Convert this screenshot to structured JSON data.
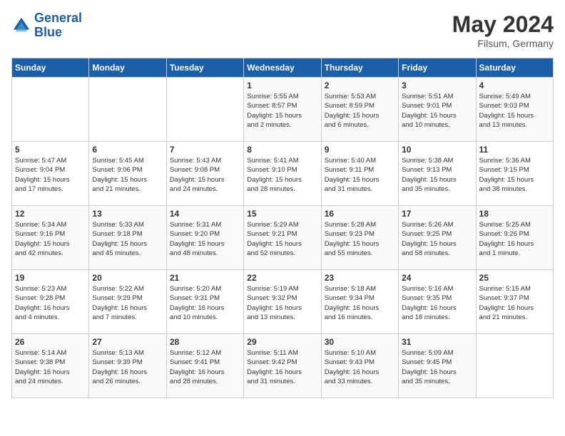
{
  "header": {
    "logo_line1": "General",
    "logo_line2": "Blue",
    "month": "May 2024",
    "location": "Filsum, Germany"
  },
  "days_of_week": [
    "Sunday",
    "Monday",
    "Tuesday",
    "Wednesday",
    "Thursday",
    "Friday",
    "Saturday"
  ],
  "weeks": [
    [
      {
        "day": "",
        "info": ""
      },
      {
        "day": "",
        "info": ""
      },
      {
        "day": "",
        "info": ""
      },
      {
        "day": "1",
        "info": "Sunrise: 5:55 AM\nSunset: 8:57 PM\nDaylight: 15 hours\nand 2 minutes."
      },
      {
        "day": "2",
        "info": "Sunrise: 5:53 AM\nSunset: 8:59 PM\nDaylight: 15 hours\nand 6 minutes."
      },
      {
        "day": "3",
        "info": "Sunrise: 5:51 AM\nSunset: 9:01 PM\nDaylight: 15 hours\nand 10 minutes."
      },
      {
        "day": "4",
        "info": "Sunrise: 5:49 AM\nSunset: 9:03 PM\nDaylight: 15 hours\nand 13 minutes."
      }
    ],
    [
      {
        "day": "5",
        "info": "Sunrise: 5:47 AM\nSunset: 9:04 PM\nDaylight: 15 hours\nand 17 minutes."
      },
      {
        "day": "6",
        "info": "Sunrise: 5:45 AM\nSunset: 9:06 PM\nDaylight: 15 hours\nand 21 minutes."
      },
      {
        "day": "7",
        "info": "Sunrise: 5:43 AM\nSunset: 9:08 PM\nDaylight: 15 hours\nand 24 minutes."
      },
      {
        "day": "8",
        "info": "Sunrise: 5:41 AM\nSunset: 9:10 PM\nDaylight: 15 hours\nand 28 minutes."
      },
      {
        "day": "9",
        "info": "Sunrise: 5:40 AM\nSunset: 9:11 PM\nDaylight: 15 hours\nand 31 minutes."
      },
      {
        "day": "10",
        "info": "Sunrise: 5:38 AM\nSunset: 9:13 PM\nDaylight: 15 hours\nand 35 minutes."
      },
      {
        "day": "11",
        "info": "Sunrise: 5:36 AM\nSunset: 9:15 PM\nDaylight: 15 hours\nand 38 minutes."
      }
    ],
    [
      {
        "day": "12",
        "info": "Sunrise: 5:34 AM\nSunset: 9:16 PM\nDaylight: 15 hours\nand 42 minutes."
      },
      {
        "day": "13",
        "info": "Sunrise: 5:33 AM\nSunset: 9:18 PM\nDaylight: 15 hours\nand 45 minutes."
      },
      {
        "day": "14",
        "info": "Sunrise: 5:31 AM\nSunset: 9:20 PM\nDaylight: 15 hours\nand 48 minutes."
      },
      {
        "day": "15",
        "info": "Sunrise: 5:29 AM\nSunset: 9:21 PM\nDaylight: 15 hours\nand 52 minutes."
      },
      {
        "day": "16",
        "info": "Sunrise: 5:28 AM\nSunset: 9:23 PM\nDaylight: 15 hours\nand 55 minutes."
      },
      {
        "day": "17",
        "info": "Sunrise: 5:26 AM\nSunset: 9:25 PM\nDaylight: 15 hours\nand 58 minutes."
      },
      {
        "day": "18",
        "info": "Sunrise: 5:25 AM\nSunset: 9:26 PM\nDaylight: 16 hours\nand 1 minute."
      }
    ],
    [
      {
        "day": "19",
        "info": "Sunrise: 5:23 AM\nSunset: 9:28 PM\nDaylight: 16 hours\nand 4 minutes."
      },
      {
        "day": "20",
        "info": "Sunrise: 5:22 AM\nSunset: 9:29 PM\nDaylight: 16 hours\nand 7 minutes."
      },
      {
        "day": "21",
        "info": "Sunrise: 5:20 AM\nSunset: 9:31 PM\nDaylight: 16 hours\nand 10 minutes."
      },
      {
        "day": "22",
        "info": "Sunrise: 5:19 AM\nSunset: 9:32 PM\nDaylight: 16 hours\nand 13 minutes."
      },
      {
        "day": "23",
        "info": "Sunrise: 5:18 AM\nSunset: 9:34 PM\nDaylight: 16 hours\nand 16 minutes."
      },
      {
        "day": "24",
        "info": "Sunrise: 5:16 AM\nSunset: 9:35 PM\nDaylight: 16 hours\nand 18 minutes."
      },
      {
        "day": "25",
        "info": "Sunrise: 5:15 AM\nSunset: 9:37 PM\nDaylight: 16 hours\nand 21 minutes."
      }
    ],
    [
      {
        "day": "26",
        "info": "Sunrise: 5:14 AM\nSunset: 9:38 PM\nDaylight: 16 hours\nand 24 minutes."
      },
      {
        "day": "27",
        "info": "Sunrise: 5:13 AM\nSunset: 9:39 PM\nDaylight: 16 hours\nand 26 minutes."
      },
      {
        "day": "28",
        "info": "Sunrise: 5:12 AM\nSunset: 9:41 PM\nDaylight: 16 hours\nand 28 minutes."
      },
      {
        "day": "29",
        "info": "Sunrise: 5:11 AM\nSunset: 9:42 PM\nDaylight: 16 hours\nand 31 minutes."
      },
      {
        "day": "30",
        "info": "Sunrise: 5:10 AM\nSunset: 9:43 PM\nDaylight: 16 hours\nand 33 minutes."
      },
      {
        "day": "31",
        "info": "Sunrise: 5:09 AM\nSunset: 9:45 PM\nDaylight: 16 hours\nand 35 minutes."
      },
      {
        "day": "",
        "info": ""
      }
    ]
  ]
}
